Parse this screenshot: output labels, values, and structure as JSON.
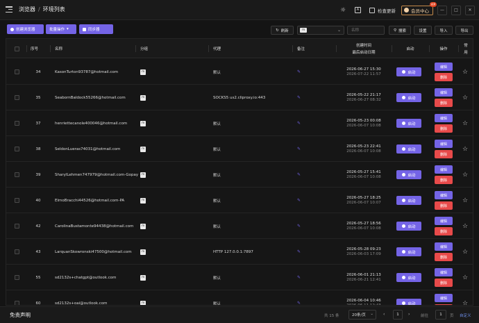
{
  "header": {
    "breadcrumb_root": "浏览器",
    "breadcrumb_sep": "/",
    "breadcrumb_current": "环境列表",
    "translate_label": "A",
    "check_update": "检查更新",
    "vip_center": "会员中心",
    "vip_badge": "VIP",
    "minimize": "—",
    "maximize": "□",
    "close": "✕"
  },
  "toolbar": {
    "create_browser": "创建浏览器",
    "batch_ops": "批量操作",
    "sync": "同步器",
    "refresh": "刷新",
    "select_tag": "m",
    "name_placeholder": "名称",
    "search": "搜索",
    "settings": "设置",
    "import": "导入",
    "export": "导出"
  },
  "table": {
    "columns": {
      "index": "序号",
      "name": "名称",
      "group": "分组",
      "proxy": "代理",
      "note": "备注",
      "created": "创建时间",
      "last_start": "最后启动日期",
      "start": "启动",
      "ops": "操作",
      "favorite_1": "常",
      "favorite_2": "用"
    },
    "start_label": "启动",
    "edit_label": "编辑",
    "delete_label": "删除",
    "rows": [
      {
        "index": "34",
        "name": "KasonTurton93787@hotmail.com",
        "group": "m",
        "proxy": "默认",
        "created": "2026-06-27 15:30",
        "last": "2026-07-22 11:57"
      },
      {
        "index": "35",
        "name": "SeabornBaldock55266@hotmail.com",
        "group": "m",
        "proxy": "SOCKS5 us2.cliproxy.io:443",
        "created": "2026-05-22 21:17",
        "last": "2026-06-27 08:32"
      },
      {
        "index": "37",
        "name": "henriettecanole400046@hotmail.com",
        "group": "m",
        "proxy": "默认",
        "created": "2026-05-23 00:08",
        "last": "2026-06-07 10:08"
      },
      {
        "index": "38",
        "name": "SeldonLueras74031@hotmail.com",
        "group": "m",
        "proxy": "默认",
        "created": "2026-05-23 22:41",
        "last": "2026-06-07 10:08"
      },
      {
        "index": "39",
        "name": "SharylLehmen747979@hotmail.com-Gopay",
        "group": "m",
        "proxy": "默认",
        "created": "2026-05-27 15:41",
        "last": "2026-06-07 10:08"
      },
      {
        "index": "40",
        "name": "ElmoBracchi44526@hotmail.com-PA",
        "group": "m",
        "proxy": "默认",
        "created": "2026-05-27 18:25",
        "last": "2026-06-07 10:07"
      },
      {
        "index": "42",
        "name": "CarolinaBustamonte94438@hotmail.com",
        "group": "m",
        "proxy": "默认",
        "created": "2026-05-27 18:56",
        "last": "2026-06-07 10:08"
      },
      {
        "index": "43",
        "name": "LarquanSkowronski47500@hotmail.com",
        "group": "m",
        "proxy": "HTTP 127.0.0.1:7897",
        "created": "2026-05-28 09:23",
        "last": "2026-06-03 17:09"
      },
      {
        "index": "55",
        "name": "sd2132s+chatgpt@outlook.com",
        "group": "m",
        "proxy": "默认",
        "created": "2026-06-01 21:13",
        "last": "2026-06-21 12:41"
      },
      {
        "index": "60",
        "name": "sd2132s+oai@outlook.com",
        "group": "m",
        "proxy": "默认",
        "created": "2026-06-04 10:46",
        "last": "2026-06-11 12:43"
      }
    ]
  },
  "footer": {
    "disclaimer": "免责声明",
    "total": "共 15 条",
    "page_size": "20条/页",
    "prev": "‹",
    "current_page": "1",
    "next": "›",
    "goto": "前往",
    "goto_value": "1",
    "page_unit": "页",
    "custom": "自定义"
  },
  "colors": {
    "accent": "#7464e6",
    "danger": "#e84a4a",
    "background": "#141414"
  }
}
